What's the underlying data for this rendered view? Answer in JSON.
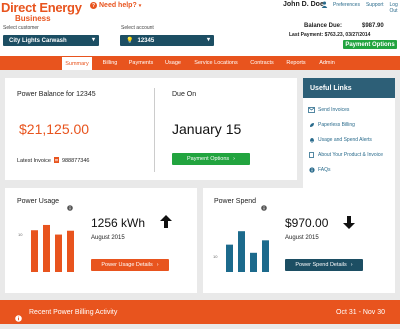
{
  "brand": {
    "name": "Direct Energy",
    "sub": "Business"
  },
  "header": {
    "help": "Need help?",
    "user_name": "John D. Doe",
    "links": [
      "Preferences",
      "Support",
      "Log Out"
    ],
    "customer_label": "Select customer",
    "customer_value": "City Lights Carwash",
    "account_label": "Select account",
    "account_value": "12345",
    "balance_label": "Balance Due:",
    "balance_value": "$987.90",
    "last_payment": "Last Payment: $763.23, 03/27/2014",
    "payment_button": "Payment Options"
  },
  "nav": [
    "Summary",
    "Billing",
    "Payments",
    "Usage",
    "Service Locations",
    "Contracts",
    "Reports",
    "Admin"
  ],
  "balance_panel": {
    "title": "Power Balance for 12345",
    "amount": "$21,125.00",
    "latest_label": "Latest Invoice",
    "latest_number": "988877346",
    "due_title": "Due On",
    "due_date": "January 15",
    "button": "Payment Options"
  },
  "useful_links": {
    "title": "Useful Links",
    "items": [
      "Send Invoices",
      "Paperless Billing",
      "Usage and Spend Alerts",
      "About Your Product & Invoice",
      "FAQs"
    ]
  },
  "usage_panel": {
    "title": "Power Usage",
    "value": "1256 kWh",
    "period": "August 2015",
    "button": "Power Usage Details",
    "axis_label": "10",
    "bars": [
      0.87,
      0.98,
      0.78,
      0.86
    ],
    "bar_color": "#e8541e",
    "trend": "up"
  },
  "spend_panel": {
    "title": "Power Spend",
    "value": "$970.00",
    "period": "August 2015",
    "button": "Power Spend Details",
    "axis_label": "10",
    "bars": [
      0.57,
      0.85,
      0.4,
      0.66
    ],
    "bar_color": "#1c6a8c",
    "trend": "down"
  },
  "footer": {
    "title": "Recent Power Billing Activity",
    "range": "Oct 31 - Nov 30"
  },
  "colors": {
    "orange": "#e8541e",
    "teal": "#1c4e63",
    "green": "#22a43f",
    "link": "#2a6b8c"
  }
}
